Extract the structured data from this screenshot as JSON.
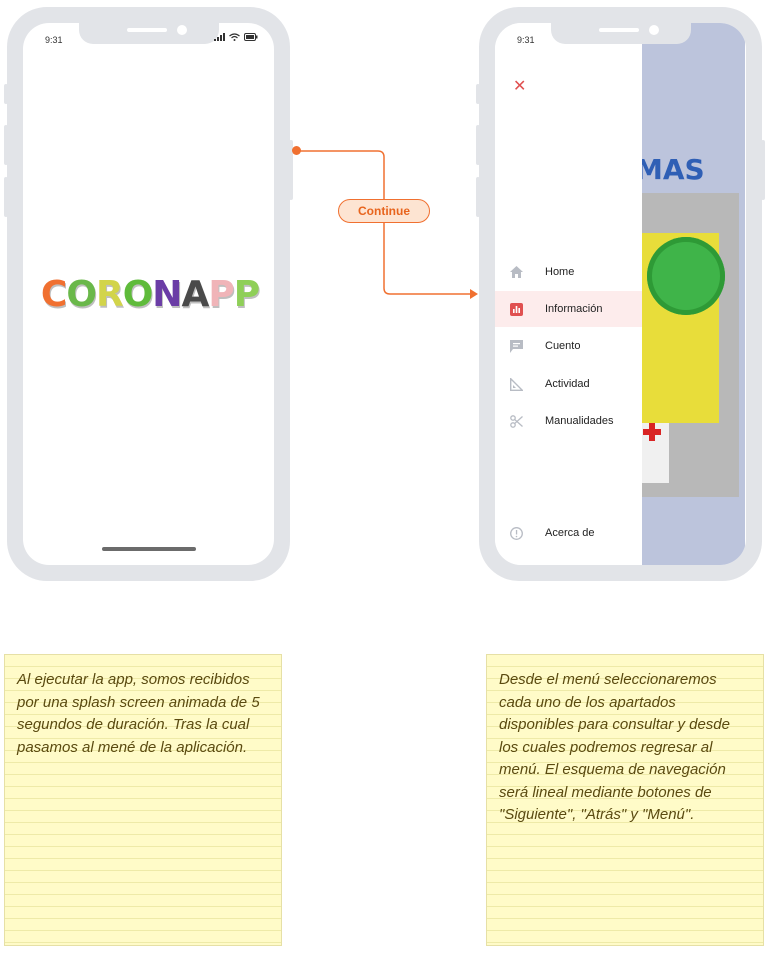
{
  "left_phone": {
    "time": "9:31",
    "logo_letters": [
      {
        "ch": "C",
        "color": "#f07030"
      },
      {
        "ch": "O",
        "color": "#6ab84a"
      },
      {
        "ch": "R",
        "color": "#d2d44a"
      },
      {
        "ch": "O",
        "color": "#5fbb3b"
      },
      {
        "ch": "N",
        "color": "#6b3da6"
      },
      {
        "ch": "A",
        "color": "#4a4a4a"
      },
      {
        "ch": "P",
        "color": "#f0b4b8"
      },
      {
        "ch": "P",
        "color": "#8fcf58"
      }
    ]
  },
  "right_phone": {
    "time": "9:31",
    "close_icon": "close-icon",
    "menu": [
      {
        "label": "Home",
        "icon": "home-icon",
        "active": false
      },
      {
        "label": "Información",
        "icon": "chart-icon",
        "active": true
      },
      {
        "label": "Cuento",
        "icon": "comment-icon",
        "active": false
      },
      {
        "label": "Actividad",
        "icon": "set-square-icon",
        "active": false
      },
      {
        "label": "Manualidades",
        "icon": "scissors-icon",
        "active": false
      },
      {
        "label": "Acerca de",
        "icon": "info-icon",
        "active": false
      }
    ],
    "bg_title": "MAS",
    "accent": "#e05050"
  },
  "flow": {
    "continue_label": "Continue",
    "accent": "#f07030"
  },
  "notes": {
    "left": "Al ejecutar la app, somos recibidos por una splash screen animada de 5 segundos de duración. Tras la cual pasamos al mené de la aplicación.",
    "right": "Desde el menú seleccionaremos cada uno de los apartados disponibles para consultar y desde los cuales podremos regresar al menú. El esquema de navegación será lineal mediante botones de \"Siguiente\", \"Atrás\" y \"Menú\"."
  }
}
